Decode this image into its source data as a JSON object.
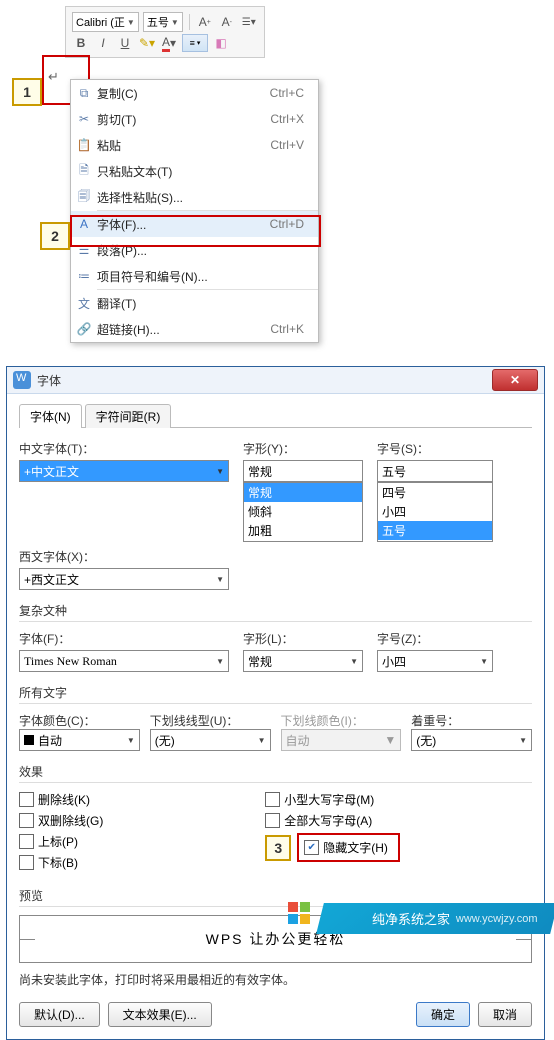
{
  "toolbar": {
    "font_name": "Calibri (正",
    "font_size": "五号",
    "bold": "B",
    "italic": "I",
    "underline": "U"
  },
  "ctx": {
    "items": [
      {
        "icon": "copy-icon",
        "label": "复制(C)",
        "sc": "Ctrl+C"
      },
      {
        "icon": "cut-icon",
        "label": "剪切(T)",
        "sc": "Ctrl+X"
      },
      {
        "icon": "paste-icon",
        "label": "粘贴",
        "sc": "Ctrl+V"
      },
      {
        "icon": "paste-text-icon",
        "label": "只粘贴文本(T)",
        "sc": ""
      },
      {
        "icon": "paste-special-icon",
        "label": "选择性粘贴(S)...",
        "sc": ""
      },
      {
        "icon": "font-icon",
        "label": "字体(F)...",
        "sc": "Ctrl+D",
        "hl": true
      },
      {
        "icon": "paragraph-icon",
        "label": "段落(P)...",
        "sc": ""
      },
      {
        "icon": "bullets-icon",
        "label": "项目符号和编号(N)...",
        "sc": ""
      },
      {
        "icon": "translate-icon",
        "label": "翻译(T)",
        "sc": ""
      },
      {
        "icon": "hyperlink-icon",
        "label": "超链接(H)...",
        "sc": "Ctrl+K"
      }
    ],
    "sep_after": [
      4,
      7
    ]
  },
  "dlg": {
    "title": "字体",
    "tabs": [
      "字体(N)",
      "字符间距(R)"
    ],
    "cn_font_label": "中文字体(T)：",
    "cn_font_value": "+中文正文",
    "style_label": "字形(Y)：",
    "style_value": "常规",
    "style_options": [
      "常规",
      "倾斜",
      "加粗"
    ],
    "size_label": "字号(S)：",
    "size_value": "五号",
    "size_options": [
      "四号",
      "小四",
      "五号"
    ],
    "we_font_label": "西文字体(X)：",
    "we_font_value": "+西文正文",
    "complex_title": "复杂文种",
    "cx_font_label": "字体(F)：",
    "cx_font_value": "Times New Roman",
    "cx_style_label": "字形(L)：",
    "cx_style_value": "常规",
    "cx_size_label": "字号(Z)：",
    "cx_size_value": "小四",
    "all_text_title": "所有文字",
    "color_label": "字体颜色(C)：",
    "color_value": "自动",
    "uline_label": "下划线线型(U)：",
    "uline_value": "(无)",
    "ucolor_label": "下划线颜色(I)：",
    "ucolor_value": "自动",
    "emph_label": "着重号：",
    "emph_value": "(无)",
    "effects_title": "效果",
    "chk_strike": "删除线(K)",
    "chk_dstrike": "双删除线(G)",
    "chk_sup": "上标(P)",
    "chk_sub": "下标(B)",
    "chk_smallcaps": "小型大写字母(M)",
    "chk_allcaps": "全部大写字母(A)",
    "chk_hidden": "隐藏文字(H)",
    "preview_title": "预览",
    "preview_text": "WPS 让办公更轻松",
    "note": "尚未安装此字体，打印时将采用最相近的有效字体。",
    "btn_default": "默认(D)...",
    "btn_textfx": "文本效果(E)...",
    "btn_ok": "确定",
    "btn_cancel": "取消"
  },
  "badges": {
    "b1": "1",
    "b2": "2",
    "b3": "3"
  },
  "wm": {
    "brand": "纯净系统之家",
    "url": "www.ycwjzy.com"
  }
}
